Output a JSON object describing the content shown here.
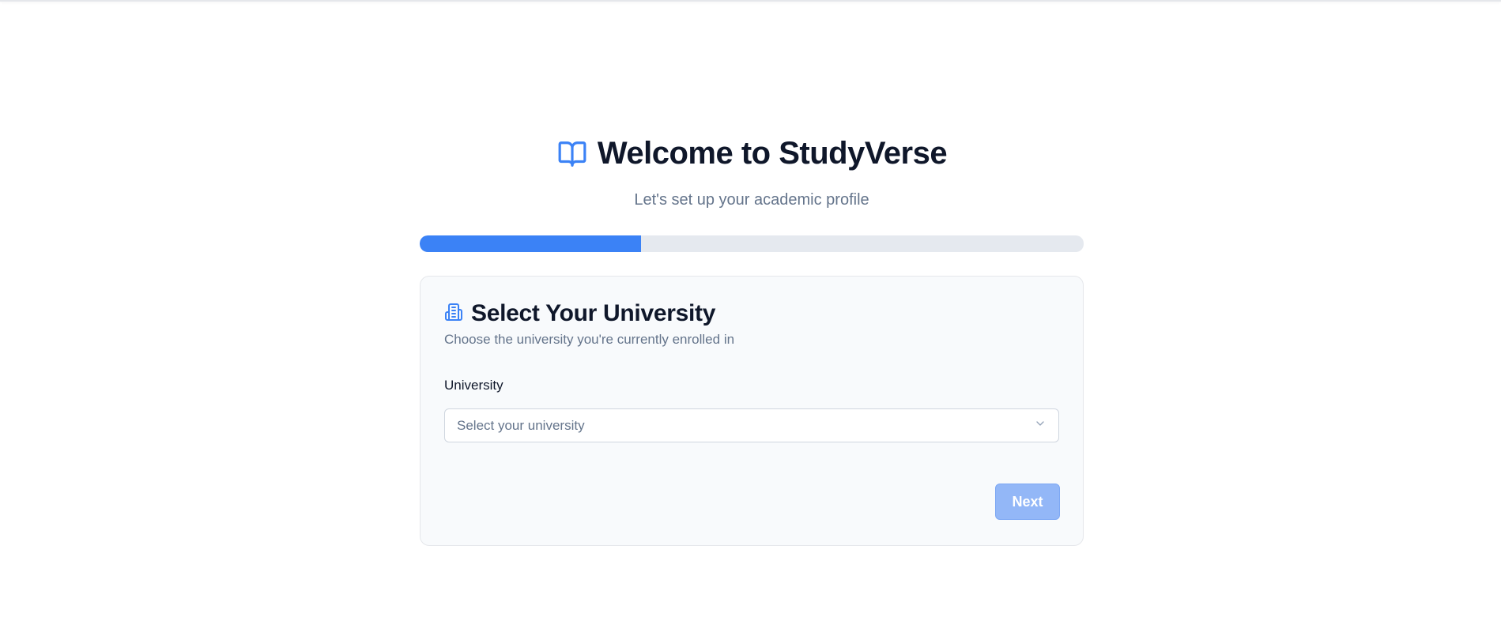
{
  "header": {
    "title": "Welcome to StudyVerse",
    "subtitle": "Let's set up your academic profile",
    "icon": "book-open-icon"
  },
  "progress": {
    "value_percent": 33.3
  },
  "card": {
    "icon": "building-icon",
    "title": "Select Your University",
    "description": "Choose the university you're currently enrolled in",
    "field_label": "University",
    "select_placeholder": "Select your university",
    "next_label": "Next"
  },
  "colors": {
    "accent": "#3b82f6",
    "progress_track": "#e5e9ef",
    "button_disabled": "#93b7f7",
    "title_text": "#0f172a",
    "muted_text": "#64748b"
  }
}
